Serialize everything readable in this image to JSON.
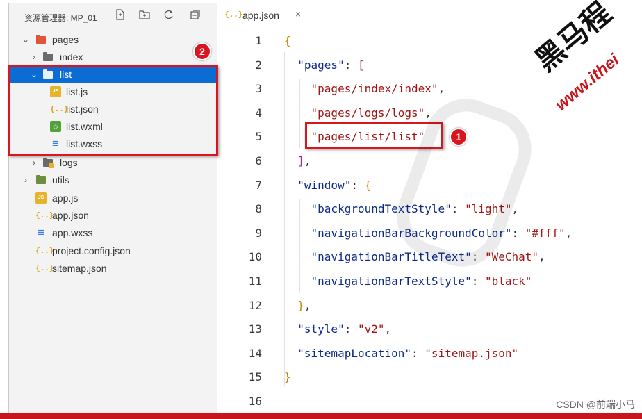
{
  "explorer": {
    "title": "资源管理器: MP_01",
    "toolbar_icons": [
      "new-file-icon",
      "new-folder-icon",
      "refresh-icon",
      "collapse-all-icon"
    ]
  },
  "tree": [
    {
      "label": "pages",
      "icon": "folder-red-icon",
      "expanded": true
    },
    {
      "label": "index",
      "icon": "folder-icon",
      "expanded": false
    },
    {
      "label": "list",
      "icon": "folder-open-icon",
      "expanded": true,
      "selected": true
    },
    {
      "label": "list.js",
      "icon": "js-file-icon"
    },
    {
      "label": "list.json",
      "icon": "json-file-icon"
    },
    {
      "label": "list.wxml",
      "icon": "wxml-file-icon"
    },
    {
      "label": "list.wxss",
      "icon": "wxss-file-icon"
    },
    {
      "label": "logs",
      "icon": "folder-icon",
      "expanded": false
    },
    {
      "label": "utils",
      "icon": "folder-green-icon",
      "expanded": false
    },
    {
      "label": "app.js",
      "icon": "js-file-icon"
    },
    {
      "label": "app.json",
      "icon": "json-file-icon"
    },
    {
      "label": "app.wxss",
      "icon": "wxss-file-icon"
    },
    {
      "label": "project.config.json",
      "icon": "json-file-icon"
    },
    {
      "label": "sitemap.json",
      "icon": "json-file-icon"
    }
  ],
  "editor": {
    "tab_label": "app.json",
    "tab_icon": "json-file-icon",
    "close_glyph": "×",
    "lines": [
      {
        "n": "1",
        "text": "{"
      },
      {
        "n": "2",
        "text": "  \"pages\": ["
      },
      {
        "n": "3",
        "text": "    \"pages/index/index\","
      },
      {
        "n": "4",
        "text": "    \"pages/logs/logs\","
      },
      {
        "n": "5",
        "text": "    \"pages/list/list\""
      },
      {
        "n": "6",
        "text": "  ],"
      },
      {
        "n": "7",
        "text": "  \"window\": {"
      },
      {
        "n": "8",
        "text": "    \"backgroundTextStyle\": \"light\","
      },
      {
        "n": "9",
        "text": "    \"navigationBarBackgroundColor\": \"#fff\","
      },
      {
        "n": "10",
        "text": "    \"navigationBarTitleText\": \"WeChat\","
      },
      {
        "n": "11",
        "text": "    \"navigationBarTextStyle\": \"black\""
      },
      {
        "n": "12",
        "text": "  },"
      },
      {
        "n": "13",
        "text": "  \"style\": \"v2\","
      },
      {
        "n": "14",
        "text": "  \"sitemapLocation\": \"sitemap.json\""
      },
      {
        "n": "15",
        "text": "}"
      },
      {
        "n": "16",
        "text": ""
      }
    ]
  },
  "annotations": {
    "badge_1": "1",
    "badge_2": "2"
  },
  "watermark": {
    "text": "黑马程",
    "url": "www.ithei"
  },
  "credit": "CSDN @前端小马",
  "colors": {
    "selection": "#0b6cd4",
    "annotation_red": "#d9161f",
    "string": "#a31515",
    "key": "#0d2a8a"
  }
}
